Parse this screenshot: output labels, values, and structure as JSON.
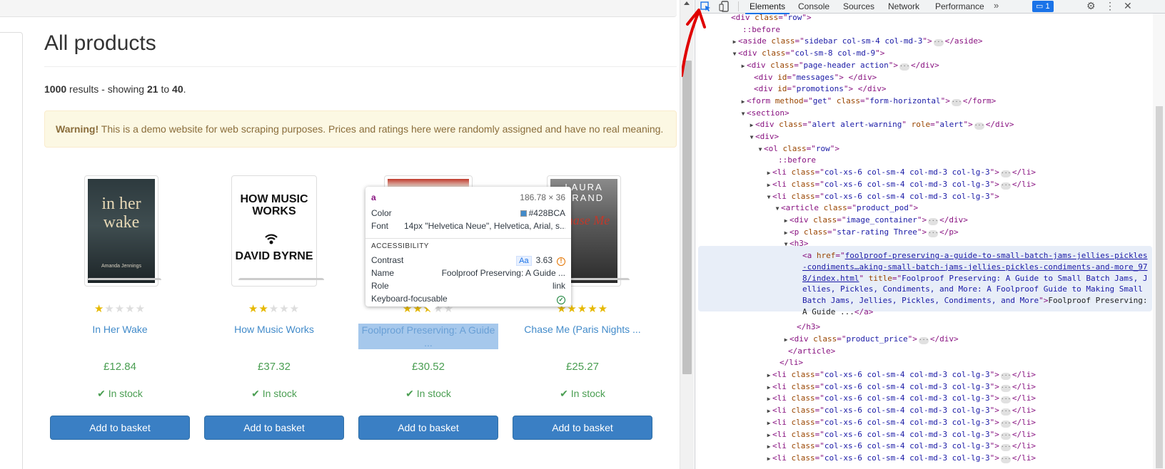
{
  "page": {
    "title": "All products",
    "results": {
      "total": "1000",
      "mid1": " results - showing ",
      "from": "21",
      "mid2": " to ",
      "to": "40",
      "end": "."
    },
    "alert": {
      "strong": "Warning!",
      "text": " This is a demo website for web scraping purposes. Prices and ratings here were randomly assigned and have no real meaning."
    }
  },
  "products": [
    {
      "title": "In Her Wake",
      "price": "£12.84",
      "stock": "In stock",
      "rating": 1,
      "button": "Add to basket",
      "cover_title": "in her wake",
      "cover_author": "Amanda Jennings"
    },
    {
      "title": "How Music Works",
      "price": "£37.32",
      "stock": "In stock",
      "rating": 2,
      "button": "Add to basket",
      "cover_title": "HOW MUSIC WORKS",
      "cover_author": "DAVID BYRNE"
    },
    {
      "title": "Foolproof Preserving: A Guide ...",
      "price": "£30.52",
      "stock": "In stock",
      "rating": 3,
      "button": "Add to basket"
    },
    {
      "title": "Chase Me (Paris Nights ...",
      "price": "£25.27",
      "stock": "In stock",
      "rating": 5,
      "button": "Add to basket",
      "cover_title": "LAURA DRAND",
      "cover_big": "Chase Me"
    }
  ],
  "tooltip": {
    "tag": "a",
    "size": "186.78 × 36",
    "color_label": "Color",
    "color_value": "#428BCA",
    "font_label": "Font",
    "font_value": "14px \"Helvetica Neue\", Helvetica, Arial, s...",
    "section": "ACCESSIBILITY",
    "contrast_label": "Contrast",
    "contrast_aa": "Aa",
    "contrast_value": "3.63",
    "name_label": "Name",
    "name_value": "Foolproof Preserving: A Guide ...",
    "role_label": "Role",
    "role_value": "link",
    "kf_label": "Keyboard-focusable"
  },
  "devtools": {
    "tabs": [
      "Elements",
      "Console",
      "Sources",
      "Network",
      "Performance"
    ],
    "active_tab": "Elements",
    "more": "»",
    "badge": "1",
    "selected_href": "foolproof-preserving-a-guide-to-small-batch-jams-jellies-pickles-condiments…aking-small-batch-jams-jellies-pickles-condiments-and-more_978/index.html",
    "selected_title": "Foolproof Preserving: A Guide to Small Batch Jams, Jellies, Pickles, Condiments, and More: A Foolproof Guide to Making Small Batch Jams, Jellies, Pickles, Condiments, and More",
    "selected_text": "Foolproof Preserving: A Guide ..."
  },
  "colors": {
    "link": "#428bca",
    "price_green": "#4a9e52",
    "button_blue": "#3a7fc4",
    "alert_bg": "#fcf8e3",
    "alert_text": "#8a6d3b",
    "star": "#e6b800",
    "annotation_red": "#e00000",
    "devtools_tag": "#881280",
    "devtools_attr_name": "#994500",
    "devtools_attr_value": "#1a1aa6"
  }
}
